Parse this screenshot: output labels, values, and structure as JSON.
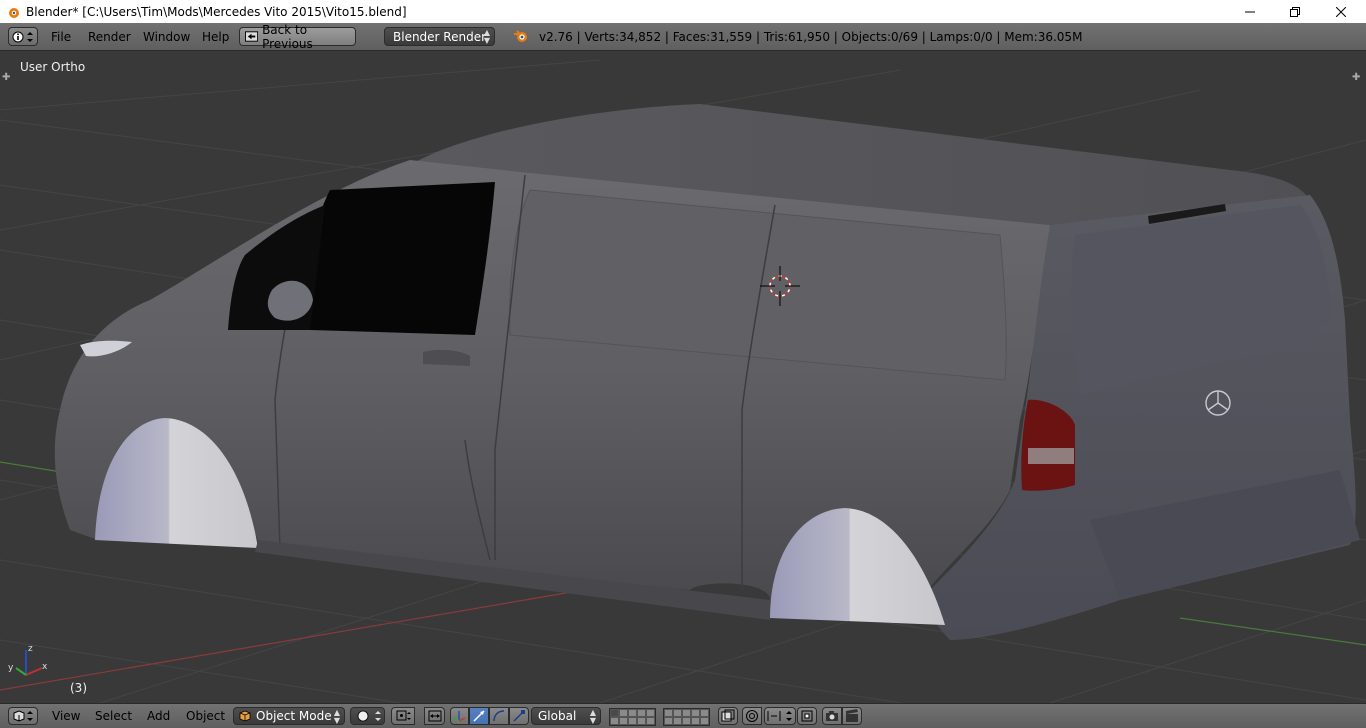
{
  "window": {
    "title": "Blender* [C:\\Users\\Tim\\Mods\\Mercedes Vito 2015\\Vito15.blend]",
    "minimize_icon": "minimize-icon",
    "maximize_icon": "restore-icon",
    "close_icon": "close-icon"
  },
  "info_header": {
    "editor_icon": "info-icon",
    "menus": [
      "File",
      "Render",
      "Window",
      "Help"
    ],
    "back_button": "Back to Previous",
    "render_engine": "Blender Render",
    "stats": "v2.76 | Verts:34,852 | Faces:31,559 | Tris:61,950 | Objects:0/69 | Lamps:0/0 | Mem:36.05M"
  },
  "viewport": {
    "view_name": "User Ortho",
    "frame": "(3)",
    "axis_labels": {
      "x": "x",
      "y": "y",
      "z": "z"
    }
  },
  "view_header": {
    "editor_icon": "3d-view-icon",
    "menus": [
      "View",
      "Select",
      "Add",
      "Object"
    ],
    "mode": "Object Mode",
    "shading_icon": "solid-shading-icon",
    "transform_orientation": "Global"
  },
  "colors": {
    "header": "#6a6a6a",
    "viewport_bg": "#393939",
    "select_blue": "#5680c2"
  }
}
